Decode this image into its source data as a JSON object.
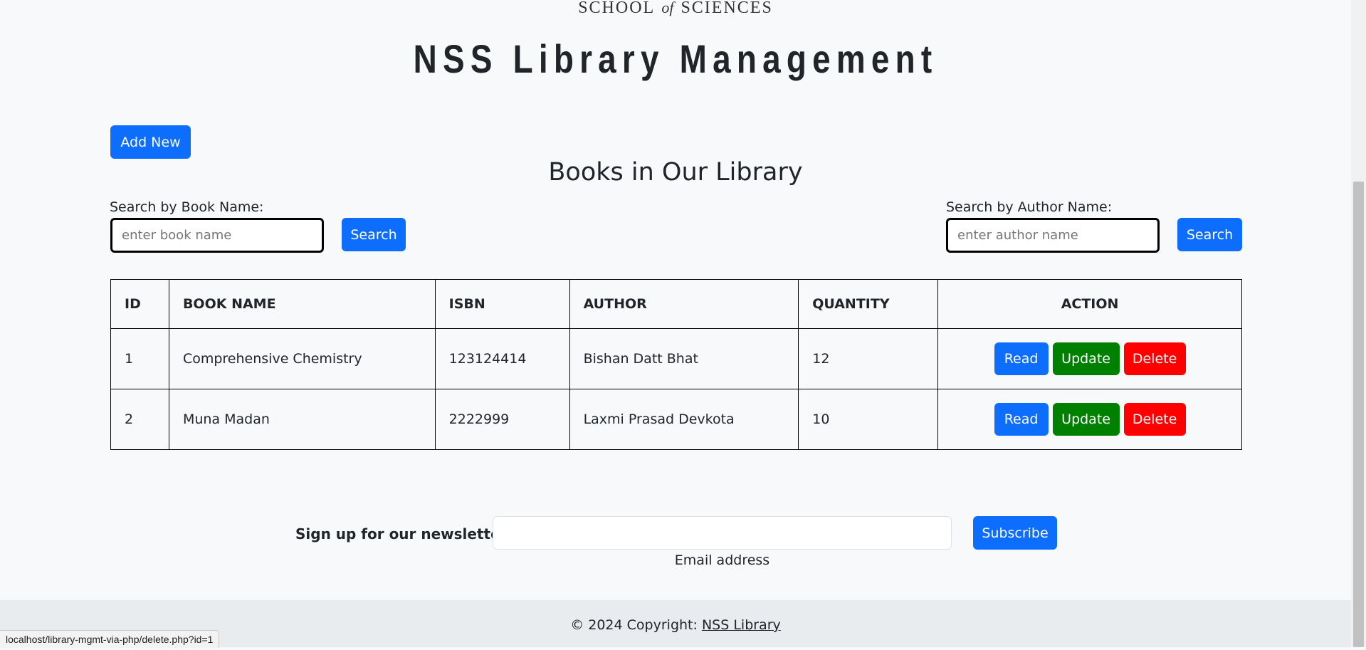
{
  "logo": {
    "school": "SCHOOL",
    "of": "of",
    "sciences": "SCIENCES"
  },
  "header": {
    "title": "NSS Library Management"
  },
  "toolbar": {
    "add_new_label": "Add New"
  },
  "section": {
    "title": "Books in Our Library"
  },
  "search_book": {
    "label": "Search by Book Name:",
    "placeholder": "enter book name",
    "button_label": "Search"
  },
  "search_author": {
    "label": "Search by Author Name:",
    "placeholder": "enter author name",
    "button_label": "Search"
  },
  "table": {
    "columns": [
      "ID",
      "BOOK NAME",
      "ISBN",
      "AUTHOR",
      "QUANTITY",
      "ACTION"
    ],
    "rows": [
      {
        "id": "1",
        "book_name": "Comprehensive Chemistry",
        "isbn": "123124414",
        "author": "Bishan Datt Bhat",
        "quantity": "12"
      },
      {
        "id": "2",
        "book_name": "Muna Madan",
        "isbn": "2222999",
        "author": "Laxmi Prasad Devkota",
        "quantity": "10"
      }
    ],
    "actions": {
      "read": "Read",
      "update": "Update",
      "delete": "Delete"
    }
  },
  "newsletter": {
    "label": "Sign up for our newsletter",
    "email_value": "",
    "email_caption": "Email address",
    "subscribe_label": "Subscribe"
  },
  "footer": {
    "prefix": "© 2024 Copyright:",
    "link": "NSS Library"
  },
  "status_bar": {
    "url": "localhost/library-mgmt-via-php/delete.php?id=1"
  },
  "colors": {
    "primary": "#0d6efd",
    "update": "#008000",
    "delete": "#ff0000",
    "background": "#f8f9fa",
    "footer_bg": "#e9ecef"
  }
}
